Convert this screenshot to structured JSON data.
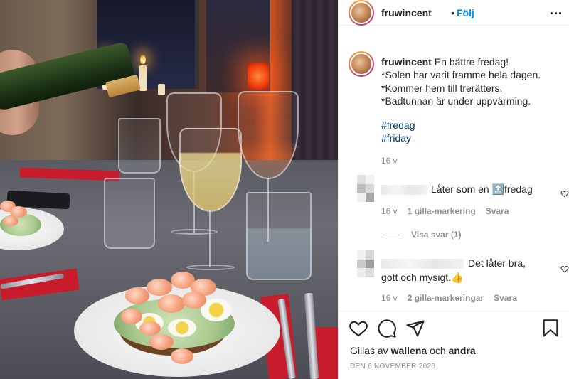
{
  "post": {
    "username": "fruwincent",
    "dot": "•",
    "follow_label": "Följ",
    "more_icon": "more-horizontal-icon"
  },
  "caption": {
    "username": "fruwincent",
    "line1": "En bättre fredag!",
    "line2": "*Solen har varit framme hela dagen.",
    "line3": "*Kommer hem till trerätters.",
    "line4": "*Badtunnan är under uppvärming.",
    "hashtags": [
      "#fredag",
      "#friday"
    ],
    "time": "16 v"
  },
  "comments": [
    {
      "text": "Låter som en",
      "emoji": "🔝",
      "text_after": "fredag",
      "time": "16 v",
      "likes": "1 gilla-markering",
      "reply": "Svara"
    },
    {
      "text": "Det låter bra,",
      "text_line2": "gott och mysigt.",
      "emoji": "👍",
      "time": "16 v",
      "likes": "2 gilla-markeringar",
      "reply": "Svara"
    }
  ],
  "view_replies": "Visa svar (1)",
  "actions": {
    "like_icon": "heart-icon",
    "comment_icon": "comment-icon",
    "share_icon": "share-icon",
    "save_icon": "bookmark-icon"
  },
  "likes": {
    "prefix": "Gillas av",
    "user": "wallena",
    "conj": "och",
    "others": "andra"
  },
  "date": "DEN 6 NOVEMBER 2020",
  "colors": {
    "link_blue": "#0095f6",
    "hashtag": "#00376b",
    "muted": "#8e8e8e",
    "text": "#262626"
  }
}
